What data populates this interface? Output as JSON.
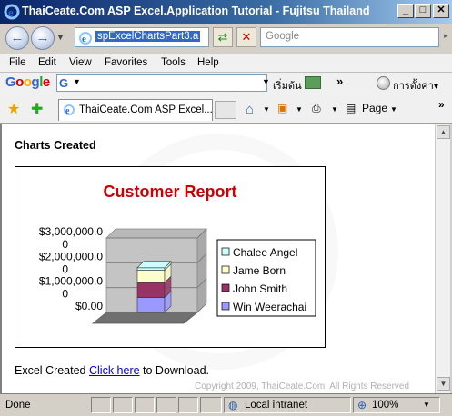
{
  "window": {
    "title": "ThaiCeate.Com ASP Excel.Application Tutorial - Fujitsu Thailand",
    "minimize": "_",
    "maximize": "□",
    "close": "✕"
  },
  "address_bar": {
    "url": "spExcelChartsPart3.a",
    "search_placeholder": "Google"
  },
  "menu": [
    "File",
    "Edit",
    "View",
    "Favorites",
    "Tools",
    "Help"
  ],
  "google_toolbar": {
    "logo": "Google",
    "start_label": "เริ่มต้น",
    "settings_label": "การตั้งค่า▾",
    "more": "»"
  },
  "tab": {
    "label": "ThaiCeate.Com ASP Excel...",
    "page_label": "Page",
    "more": "»"
  },
  "content": {
    "heading": "Charts Created",
    "footer_prefix": "Excel Created ",
    "footer_link": "Click here",
    "footer_suffix": " to Download.",
    "copyright": "Copyright 2009, ThaiCeate.Com. All Rights Reserved"
  },
  "status": {
    "text": "Done",
    "zone": "Local intranet",
    "zoom": "100%"
  },
  "colors": {
    "title_red": "#cc0000",
    "link": "#0000cc",
    "series_chalee": "#ccffff",
    "series_jame": "#ffffcc",
    "series_john": "#993366",
    "series_win": "#9999ff"
  },
  "chart_data": {
    "type": "bar",
    "title": "Customer Report",
    "y_tick_labels": [
      "$3,000,000.00",
      "$2,000,000.00",
      "$1,000,000.00",
      "$0.00"
    ],
    "ylim": [
      0,
      3000000
    ],
    "stacked": true,
    "legend_position": "right",
    "grid": true,
    "series": [
      {
        "name": "Chalee Angel",
        "values": [
          100000
        ],
        "color": "#ccffff"
      },
      {
        "name": "Jame Born",
        "values": [
          500000
        ],
        "color": "#ffffcc"
      },
      {
        "name": "John Smith",
        "values": [
          600000
        ],
        "color": "#993366"
      },
      {
        "name": "Win Weerachai",
        "values": [
          600000
        ],
        "color": "#9999ff"
      }
    ]
  }
}
